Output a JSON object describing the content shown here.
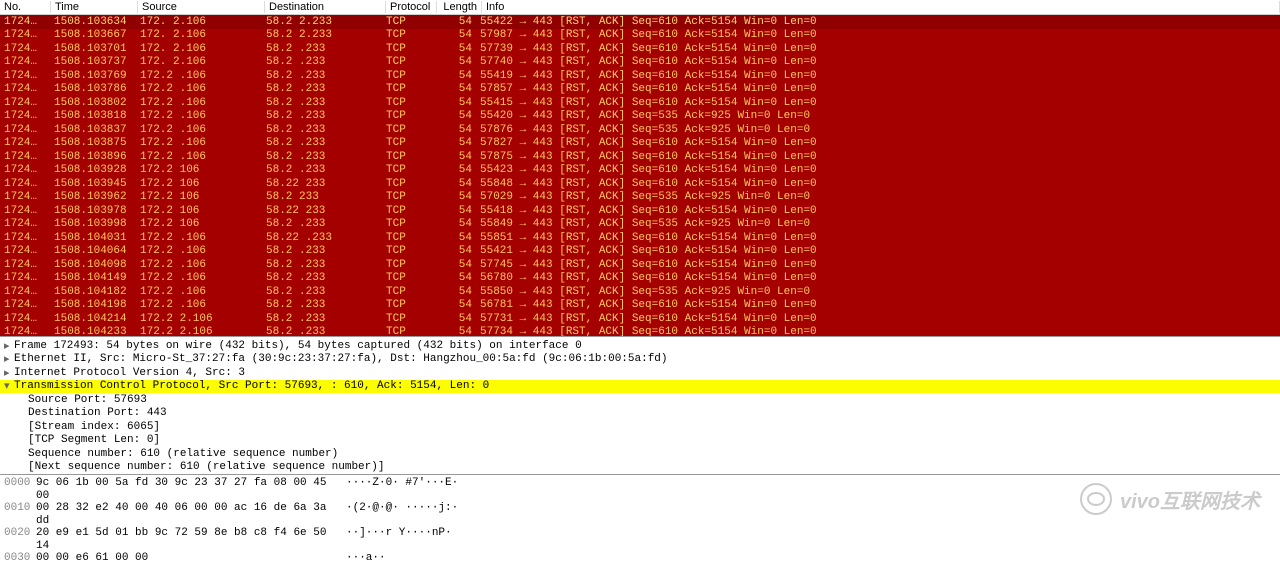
{
  "columns": {
    "no": "No.",
    "time": "Time",
    "source": "Source",
    "destination": "Destination",
    "protocol": "Protocol",
    "length": "Length",
    "info": "Info"
  },
  "packets": [
    {
      "no": "1724…",
      "time": "1508.103634",
      "src": "172.    2.106",
      "dst": "58.2    2.233",
      "proto": "TCP",
      "len": "54",
      "info": "55422 → 443 [RST, ACK] Seq=610 Ack=5154 Win=0 Len=0",
      "selected": true
    },
    {
      "no": "1724…",
      "time": "1508.103667",
      "src": "172.   2.106",
      "dst": "58.2    2.233",
      "proto": "TCP",
      "len": "54",
      "info": "57987 → 443 [RST, ACK] Seq=610 Ack=5154 Win=0 Len=0"
    },
    {
      "no": "1724…",
      "time": "1508.103701",
      "src": "172.   2.106",
      "dst": "58.2    .233",
      "proto": "TCP",
      "len": "54",
      "info": "57739 → 443 [RST, ACK] Seq=610 Ack=5154 Win=0 Len=0"
    },
    {
      "no": "1724…",
      "time": "1508.103737",
      "src": "172.   2.106",
      "dst": "58.2    .233",
      "proto": "TCP",
      "len": "54",
      "info": "57740 → 443 [RST, ACK] Seq=610 Ack=5154 Win=0 Len=0"
    },
    {
      "no": "1724…",
      "time": "1508.103769",
      "src": "172.2  .106",
      "dst": "58.2    .233",
      "proto": "TCP",
      "len": "54",
      "info": "55419 → 443 [RST, ACK] Seq=610 Ack=5154 Win=0 Len=0"
    },
    {
      "no": "1724…",
      "time": "1508.103786",
      "src": "172.2  .106",
      "dst": "58.2    .233",
      "proto": "TCP",
      "len": "54",
      "info": "57857 → 443 [RST, ACK] Seq=610 Ack=5154 Win=0 Len=0"
    },
    {
      "no": "1724…",
      "time": "1508.103802",
      "src": "172.2  .106",
      "dst": "58.2    .233",
      "proto": "TCP",
      "len": "54",
      "info": "55415 → 443 [RST, ACK] Seq=610 Ack=5154 Win=0 Len=0"
    },
    {
      "no": "1724…",
      "time": "1508.103818",
      "src": "172.2  .106",
      "dst": "58.2    .233",
      "proto": "TCP",
      "len": "54",
      "info": "55420 → 443 [RST, ACK] Seq=535 Ack=925 Win=0 Len=0"
    },
    {
      "no": "1724…",
      "time": "1508.103837",
      "src": "172.2  .106",
      "dst": "58.2    .233",
      "proto": "TCP",
      "len": "54",
      "info": "57876 → 443 [RST, ACK] Seq=535 Ack=925 Win=0 Len=0"
    },
    {
      "no": "1724…",
      "time": "1508.103875",
      "src": "172.2  .106",
      "dst": "58.2    .233",
      "proto": "TCP",
      "len": "54",
      "info": "57827 → 443 [RST, ACK] Seq=610 Ack=5154 Win=0 Len=0"
    },
    {
      "no": "1724…",
      "time": "1508.103896",
      "src": "172.2  .106",
      "dst": "58.2    .233",
      "proto": "TCP",
      "len": "54",
      "info": "57875 → 443 [RST, ACK] Seq=610 Ack=5154 Win=0 Len=0"
    },
    {
      "no": "1724…",
      "time": "1508.103928",
      "src": "172.2   106",
      "dst": "58.2    .233",
      "proto": "TCP",
      "len": "54",
      "info": "55423 → 443 [RST, ACK] Seq=610 Ack=5154 Win=0 Len=0"
    },
    {
      "no": "1724…",
      "time": "1508.103945",
      "src": "172.2   106",
      "dst": "58.22   233",
      "proto": "TCP",
      "len": "54",
      "info": "55848 → 443 [RST, ACK] Seq=610 Ack=5154 Win=0 Len=0"
    },
    {
      "no": "1724…",
      "time": "1508.103962",
      "src": "172.2   106",
      "dst": "58.2    233",
      "proto": "TCP",
      "len": "54",
      "info": "57029 → 443 [RST, ACK] Seq=535 Ack=925 Win=0 Len=0"
    },
    {
      "no": "1724…",
      "time": "1508.103978",
      "src": "172.2   106",
      "dst": "58.22   233",
      "proto": "TCP",
      "len": "54",
      "info": "55418 → 443 [RST, ACK] Seq=610 Ack=5154 Win=0 Len=0"
    },
    {
      "no": "1724…",
      "time": "1508.103998",
      "src": "172.2   106",
      "dst": "58.2    .233",
      "proto": "TCP",
      "len": "54",
      "info": "55849 → 443 [RST, ACK] Seq=535 Ack=925 Win=0 Len=0"
    },
    {
      "no": "1724…",
      "time": "1508.104031",
      "src": "172.2  .106",
      "dst": "58.22   .233",
      "proto": "TCP",
      "len": "54",
      "info": "55851 → 443 [RST, ACK] Seq=610 Ack=5154 Win=0 Len=0"
    },
    {
      "no": "1724…",
      "time": "1508.104064",
      "src": "172.2  .106",
      "dst": "58.2    .233",
      "proto": "TCP",
      "len": "54",
      "info": "55421 → 443 [RST, ACK] Seq=610 Ack=5154 Win=0 Len=0"
    },
    {
      "no": "1724…",
      "time": "1508.104098",
      "src": "172.2  .106",
      "dst": "58.2    .233",
      "proto": "TCP",
      "len": "54",
      "info": "57745 → 443 [RST, ACK] Seq=610 Ack=5154 Win=0 Len=0"
    },
    {
      "no": "1724…",
      "time": "1508.104149",
      "src": "172.2  .106",
      "dst": "58.2    .233",
      "proto": "TCP",
      "len": "54",
      "info": "56780 → 443 [RST, ACK] Seq=610 Ack=5154 Win=0 Len=0"
    },
    {
      "no": "1724…",
      "time": "1508.104182",
      "src": "172.2  .106",
      "dst": "58.2    .233",
      "proto": "TCP",
      "len": "54",
      "info": "55850 → 443 [RST, ACK] Seq=535 Ack=925 Win=0 Len=0"
    },
    {
      "no": "1724…",
      "time": "1508.104198",
      "src": "172.2  .106",
      "dst": "58.2    .233",
      "proto": "TCP",
      "len": "54",
      "info": "56781 → 443 [RST, ACK] Seq=610 Ack=5154 Win=0 Len=0"
    },
    {
      "no": "1724…",
      "time": "1508.104214",
      "src": "172.2  2.106",
      "dst": "58.2    .233",
      "proto": "TCP",
      "len": "54",
      "info": "57731 → 443 [RST, ACK] Seq=610 Ack=5154 Win=0 Len=0"
    },
    {
      "no": "1724…",
      "time": "1508.104233",
      "src": "172.2  2.106",
      "dst": "58.2    .233",
      "proto": "TCP",
      "len": "54",
      "info": "57734 → 443 [RST, ACK] Seq=610 Ack=5154 Win=0 Len=0"
    }
  ],
  "details": {
    "frame": "Frame 172493: 54 bytes on wire (432 bits), 54 bytes captured (432 bits) on interface 0",
    "ethernet": "Ethernet II, Src: Micro-St_37:27:fa (30:9c:23:37:27:fa), Dst: Hangzhou_00:5a:fd (9c:06:1b:00:5a:fd)",
    "ip": "Internet Protocol Version 4, Src:                                 3",
    "tcp": "Transmission Control Protocol, Src Port: 57693,                      : 610, Ack: 5154, Len: 0",
    "src_port": "Source Port: 57693",
    "dst_port": "Destination Port: 443",
    "stream": "[Stream index: 6065]",
    "seglen": "[TCP Segment Len: 0]",
    "seqnum": "Sequence number: 610    (relative sequence number)",
    "nextseq": "[Next sequence number: 610    (relative sequence number)]"
  },
  "bytes": [
    {
      "off": "0000",
      "hex": "9c 06 1b 00 5a fd 30 9c  23 37 27 fa 08 00 45 00",
      "ascii": "····Z·0· #7'···E·"
    },
    {
      "off": "0010",
      "hex": "00 28 32 e2 40 00 40 06  00 00 ac 16 de 6a 3a dd",
      "ascii": "·(2·@·@· ·····j:·"
    },
    {
      "off": "0020",
      "hex": "20 e9 e1 5d 01 bb 9c 72  59 8e b8 c8 f4 6e 50 14",
      "ascii": " ··]···r Y····nP·"
    },
    {
      "off": "0030",
      "hex": "00 00 e6 61 00 00",
      "ascii": "···a··"
    }
  ],
  "watermark": "vivo互联网技术"
}
